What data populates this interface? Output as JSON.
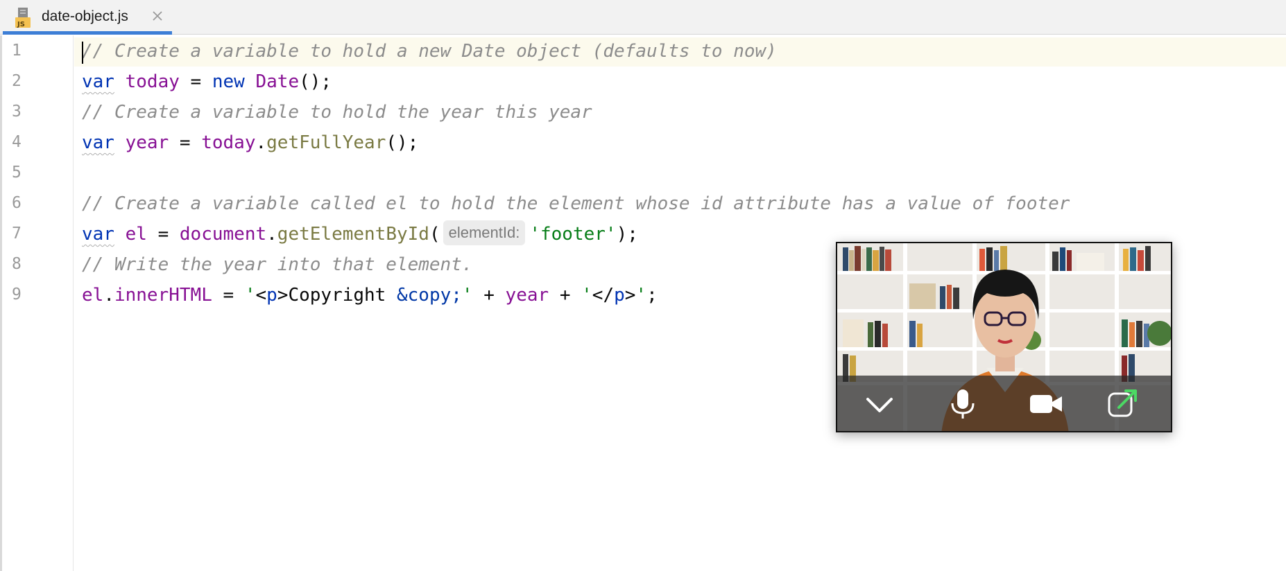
{
  "editor": {
    "tab": {
      "file_name": "date-object.js",
      "file_type_badge": "JS",
      "icon": "js-file-icon",
      "close_icon": "close-icon"
    },
    "line_numbers": [
      "1",
      "2",
      "3",
      "4",
      "5",
      "6",
      "7",
      "8",
      "9"
    ],
    "lines": {
      "l1": {
        "comment": "// Create a variable to hold a new Date object (defaults to now)"
      },
      "l2": {
        "kw": "var",
        "name": "today",
        "eq": " = ",
        "new": "new",
        "cls": "Date",
        "tail": "();"
      },
      "l3": {
        "comment": "// Create a variable to hold the year this year"
      },
      "l4": {
        "kw": "var",
        "name": "year",
        "eq": " = ",
        "obj": "today",
        "dot": ".",
        "fn": "getFullYear",
        "tail": "();"
      },
      "l6": {
        "comment": "// Create a variable called el to hold the element whose id attribute has a value of footer"
      },
      "l7": {
        "kw": "var",
        "name": "el",
        "eq": " = ",
        "obj": "document",
        "dot": ".",
        "fn": "getElementById",
        "open": "(",
        "hint": "elementId:",
        "arg": "'footer'",
        "tail": ");"
      },
      "l8": {
        "comment": "// Write the year into that element."
      },
      "l9": {
        "obj": "el",
        "dot": ".",
        "prop": "innerHTML",
        "eq": " = ",
        "q1": "'",
        "lt1": "<",
        "tag1": "p",
        "gt1": ">",
        "text": "Copyright ",
        "entity": "&copy;",
        "q2": "'",
        "plus1": " + ",
        "year": "year",
        "plus2": " + ",
        "q3": "'",
        "lt2": "</",
        "tag2": "p",
        "gt2": ">",
        "q4": "'",
        "semi": ";"
      }
    }
  },
  "video_overlay": {
    "controls": [
      "chevron-down-icon",
      "microphone-icon",
      "video-camera-icon",
      "pop-out-icon"
    ],
    "accent_color": "#4cd964"
  },
  "colors": {
    "comment": "#8c8c8c",
    "keyword": "#0033b3",
    "variable": "#871094",
    "function": "#7a7a43",
    "string": "#067d17",
    "tab_underline": "#3d7ed6"
  }
}
